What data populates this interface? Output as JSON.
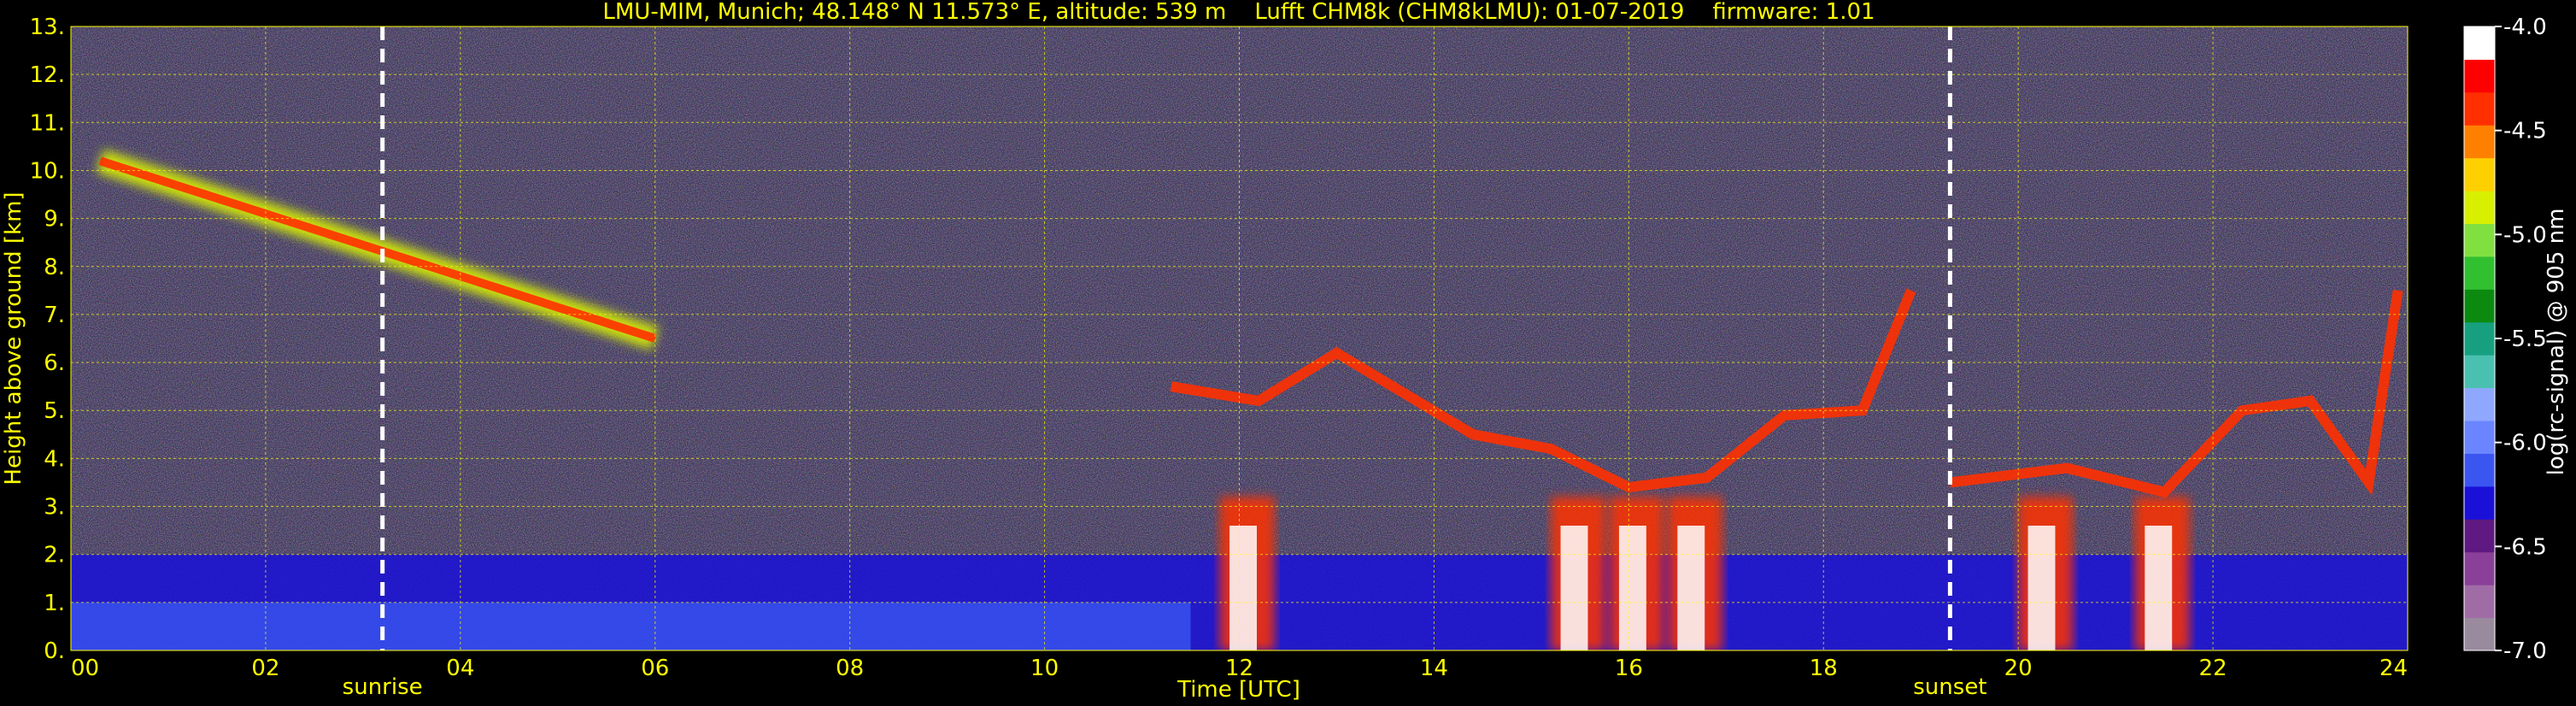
{
  "chart_data": {
    "type": "heatmap",
    "title": "LMU-MIM, Munich; 48.148° N 11.573° E, altitude: 539 m    Lufft CHM8k (CHM8kLMU): 01-07-2019    firmware: 1.01",
    "xlabel": "Time [UTC]",
    "ylabel": "Height above ground [km]",
    "xlim": [
      0,
      24
    ],
    "ylim": [
      0,
      13
    ],
    "x_ticks": [
      "00",
      "02",
      "04",
      "06",
      "08",
      "10",
      "12",
      "14",
      "16",
      "18",
      "20",
      "22",
      "24"
    ],
    "y_ticks": [
      "0.",
      "1.",
      "2.",
      "3.",
      "4.",
      "5.",
      "6.",
      "7.",
      "8.",
      "9.",
      "10.",
      "11.",
      "12.",
      "13."
    ],
    "grid": true,
    "markers": [
      {
        "label": "sunrise",
        "x": 3.2
      },
      {
        "label": "sunset",
        "x": 19.3
      }
    ],
    "colorbar": {
      "label": "log(rc-signal) @ 905 nm",
      "ticks": [
        "-4.0",
        "-4.5",
        "-5.0",
        "-5.5",
        "-6.0",
        "-6.5",
        "-7.0"
      ],
      "range": [
        -7.0,
        -4.0
      ],
      "colors": [
        "#9a8a9e",
        "#a06ca6",
        "#8a3f98",
        "#5e1a82",
        "#1a10d8",
        "#3a55f0",
        "#6a85ff",
        "#8fa8ff",
        "#4ac0b0",
        "#16a080",
        "#0c8a10",
        "#30c030",
        "#80e040",
        "#d8f000",
        "#ffd000",
        "#ff8000",
        "#ff3000",
        "#ff0000",
        "#ffffff"
      ]
    },
    "layers": [
      {
        "name": "aerosol",
        "x": [
          0,
          24
        ],
        "y": [
          0,
          2.0
        ],
        "value": -6.4
      },
      {
        "name": "cloud-cirrus",
        "x": [
          0.3,
          6.0
        ],
        "y": [
          6.5,
          10.2
        ],
        "value": -4.8
      },
      {
        "name": "cloud-convective",
        "x": [
          11.2,
          24.0
        ],
        "y": [
          0,
          7.5
        ],
        "value": -4.4
      }
    ]
  },
  "colors": {
    "background": "#000000",
    "text": "#ffff00",
    "grid": "#ffff00",
    "marker": "#ffffff"
  }
}
